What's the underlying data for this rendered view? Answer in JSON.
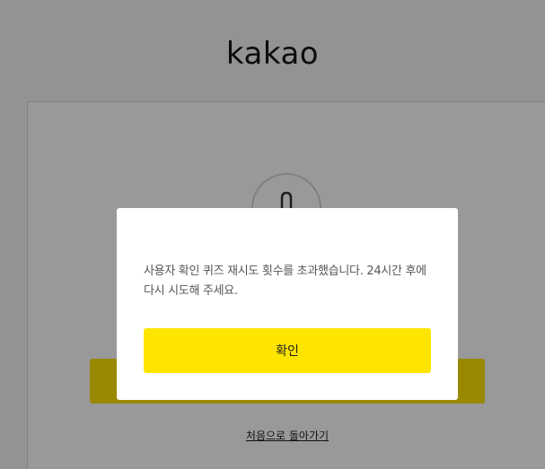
{
  "logo": {
    "text": "kakao"
  },
  "background": {
    "primary_button_label": "",
    "back_link": "처음으로 돌아가기"
  },
  "icons": {
    "lock": "lock-icon"
  },
  "modal": {
    "message_line1": "사용자 확인 퀴즈 재시도 횟수를 초과했습니다. 24시간 후에",
    "message_line2": "다시 시도해 주세요.",
    "confirm_label": "확인"
  },
  "colors": {
    "accent": "#fee500",
    "overlay": "rgba(0,0,0,0.4)",
    "text": "#555555"
  }
}
